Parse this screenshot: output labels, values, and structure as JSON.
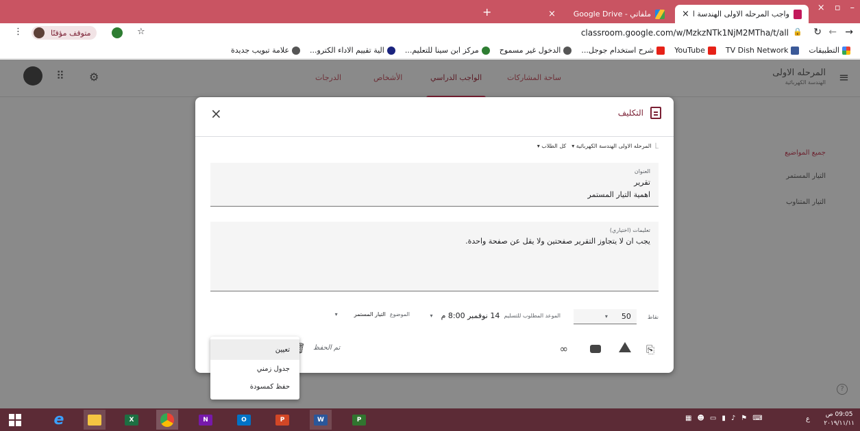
{
  "browser": {
    "tabs": [
      {
        "title": "واجب المرحله الاولى الهندسة الكهرب",
        "close": "×",
        "active": true
      },
      {
        "title": "ملفاتي - Google Drive",
        "close": "×",
        "active": false
      }
    ],
    "new_tab": "+",
    "window_close": "×",
    "url": "classroom.google.com/w/MzkzNTk1NjM2MTha/t/all",
    "profile_label": "متوقف مؤقتًا",
    "bookmarks": [
      {
        "label": "التطبيقات",
        "color": "#4285f4"
      },
      {
        "label": "TV Dish Network",
        "color": "#3b5998"
      },
      {
        "label": "YouTube",
        "color": "#e62117"
      },
      {
        "label": "شرح استخدام جوجل...",
        "color": "#e62117"
      },
      {
        "label": "الدخول غير مسموح",
        "color": "#555555"
      },
      {
        "label": "مركز ابن سينا للتعليم...",
        "color": "#2e7d32"
      },
      {
        "label": "الية تقييم الاداء الكترو...",
        "color": "#1a237e"
      },
      {
        "label": "علامة تبويب جديدة",
        "color": "#555555"
      }
    ]
  },
  "classroom": {
    "class_name": "المرحله الاولى",
    "class_section": "الهندسة الكهربائية",
    "nav_tabs": [
      {
        "label": "ساحة المشاركات",
        "active": false
      },
      {
        "label": "الواجب الدراسي",
        "active": true
      },
      {
        "label": "الأشخاص",
        "active": false
      },
      {
        "label": "الدرجات",
        "active": false
      }
    ],
    "sidebar": [
      {
        "label": "جميع المواضيع",
        "active": true
      },
      {
        "label": "التيار المستمر",
        "active": false
      },
      {
        "label": "التيار المتناوب",
        "active": false
      }
    ]
  },
  "modal": {
    "title": "التكليف",
    "close": "×",
    "class_select": "المرحله الاولى الهندسة الكهربائية",
    "students_select": "كل الطلاب",
    "title_field": {
      "label": "العنوان",
      "lines": [
        "تقرير",
        "اهمية التيار المستمر"
      ]
    },
    "instructions_field": {
      "label": "تعليمات (اختياري)",
      "value": "يجب ان لا يتجاوز التقرير صفحتين ولا يقل عن صفحة واحدة."
    },
    "points_label": "نقاط",
    "points_value": "50",
    "due_label": "الموعد المطلوب للتسليم",
    "due_value": "14 نوفمبر 8:00 م",
    "topic_label": "الموضوع",
    "topic_value": "التيار المستمر",
    "saved_label": "تم الحفظ"
  },
  "dropdown_menu": {
    "items": [
      "تعيين",
      "جدول زمني",
      "حفظ كمسودة"
    ]
  },
  "taskbar": {
    "clock_time": "09:05 ص",
    "clock_date": "٢٠١٩/١١/١١",
    "lang": "ع",
    "app_labels": {
      "excel": "X",
      "onenote": "N",
      "outlook": "O",
      "powerpoint": "P",
      "word": "W",
      "project": "P"
    }
  },
  "colors": {
    "brand": "#7a1f33",
    "tabbar": "#c95462",
    "overlay": "#8a8a8a",
    "taskbar": "#5c2b36"
  }
}
